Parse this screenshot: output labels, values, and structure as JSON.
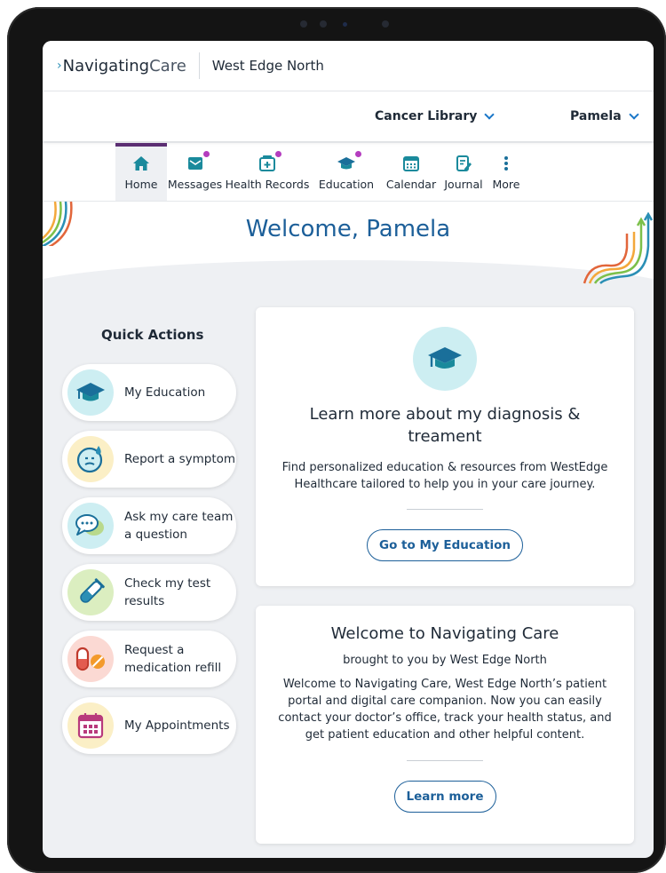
{
  "app": {
    "logo_main": "Navigating",
    "logo_accent": "Care",
    "org_name": "West Edge North"
  },
  "subbar": {
    "library_label": "Cancer Library",
    "user_label": "Pamela"
  },
  "tabs": [
    {
      "label": "Home",
      "icon": "home-icon",
      "active": true
    },
    {
      "label": "Messages",
      "icon": "envelope-icon",
      "badge": true
    },
    {
      "label": "Health Records",
      "icon": "medical-folder-icon",
      "badge": true
    },
    {
      "label": "Education",
      "icon": "graduation-cap-icon",
      "badge": true
    },
    {
      "label": "Calendar",
      "icon": "calendar-icon"
    },
    {
      "label": "Journal",
      "icon": "journal-icon"
    },
    {
      "label": "More",
      "icon": "more-vertical-icon"
    }
  ],
  "welcome": {
    "title": "Welcome, Pamela"
  },
  "quick_actions": {
    "title": "Quick Actions",
    "items": [
      {
        "label": "My Education",
        "icon": "graduation-cap-icon"
      },
      {
        "label": "Report a symptom",
        "icon": "face-symptom-icon"
      },
      {
        "label": "Ask my care team a question",
        "icon": "chat-bubbles-icon"
      },
      {
        "label": "Check my test results",
        "icon": "test-tube-icon"
      },
      {
        "label": "Request a medication refill",
        "icon": "pills-icon"
      },
      {
        "label": "My Appointments",
        "icon": "calendar-icon"
      }
    ]
  },
  "cards": {
    "education": {
      "title": "Learn more about my diagnosis & treament",
      "body": "Find personalized education & resources from WestEdge Healthcare tailored to help you in your care journey.",
      "button": "Go to My Education"
    },
    "welcome": {
      "title": "Welcome to Navigating Care",
      "subtitle": "brought to you by West Edge North",
      "body": "Welcome to Navigating Care, West Edge North’s patient portal and digital care companion. Now you can easily contact your doctor’s office, track your health status, and get patient education and other helpful content.",
      "button": "Learn more"
    }
  },
  "colors": {
    "primary_blue": "#1c5f99",
    "accent_purple": "#5b2e72",
    "badge_magenta": "#b43dbf",
    "teal": "#2a8fb5"
  }
}
